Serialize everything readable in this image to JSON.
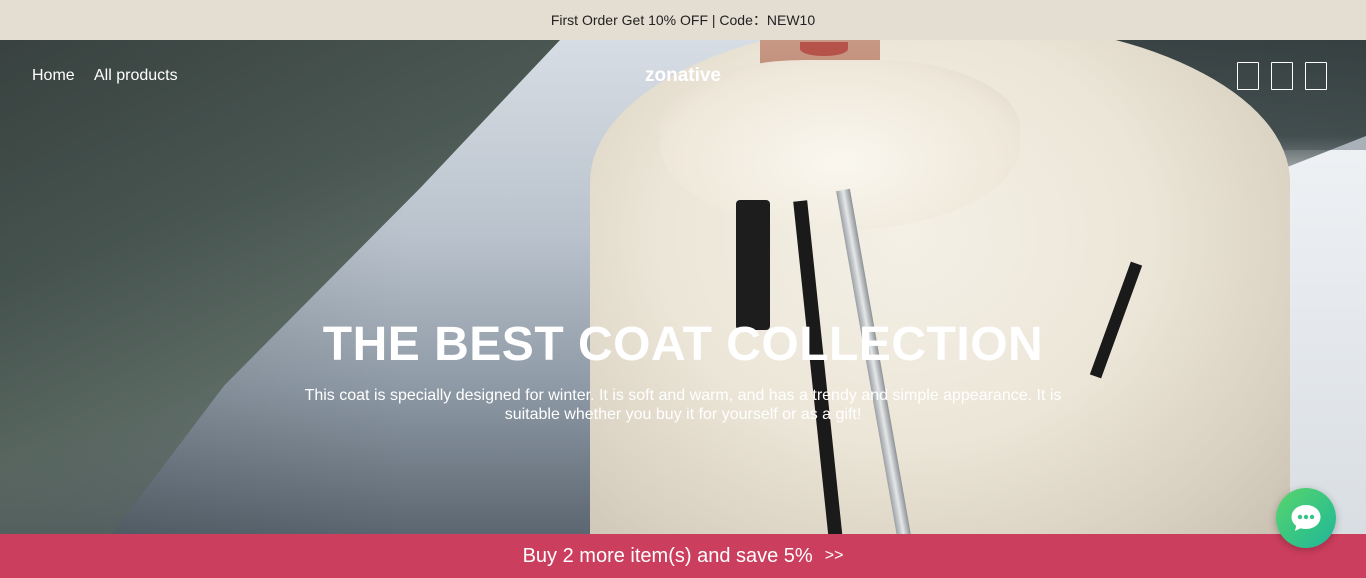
{
  "announcement": {
    "text": "First Order Get 10% OFF | Code：NEW10"
  },
  "nav": {
    "links": [
      {
        "label": "Home"
      },
      {
        "label": "All products"
      }
    ],
    "brand": "zonative",
    "icons": [
      "search-icon",
      "account-icon",
      "cart-icon"
    ]
  },
  "hero": {
    "title": "THE BEST COAT COLLECTION",
    "description": "This coat is specially designed for winter. It is soft and warm, and has a trendy and simple appearance. It is suitable whether you buy it for yourself or as a gift!"
  },
  "promo_bar": {
    "text": "Buy 2 more item(s) and save 5%",
    "arrows": ">>"
  },
  "chat": {
    "icon": "chat-bubble-icon"
  },
  "colors": {
    "announcement_bg": "#e4ddd1",
    "promo_bg": "#cc3e5d",
    "chat_bg": "#34c486"
  }
}
